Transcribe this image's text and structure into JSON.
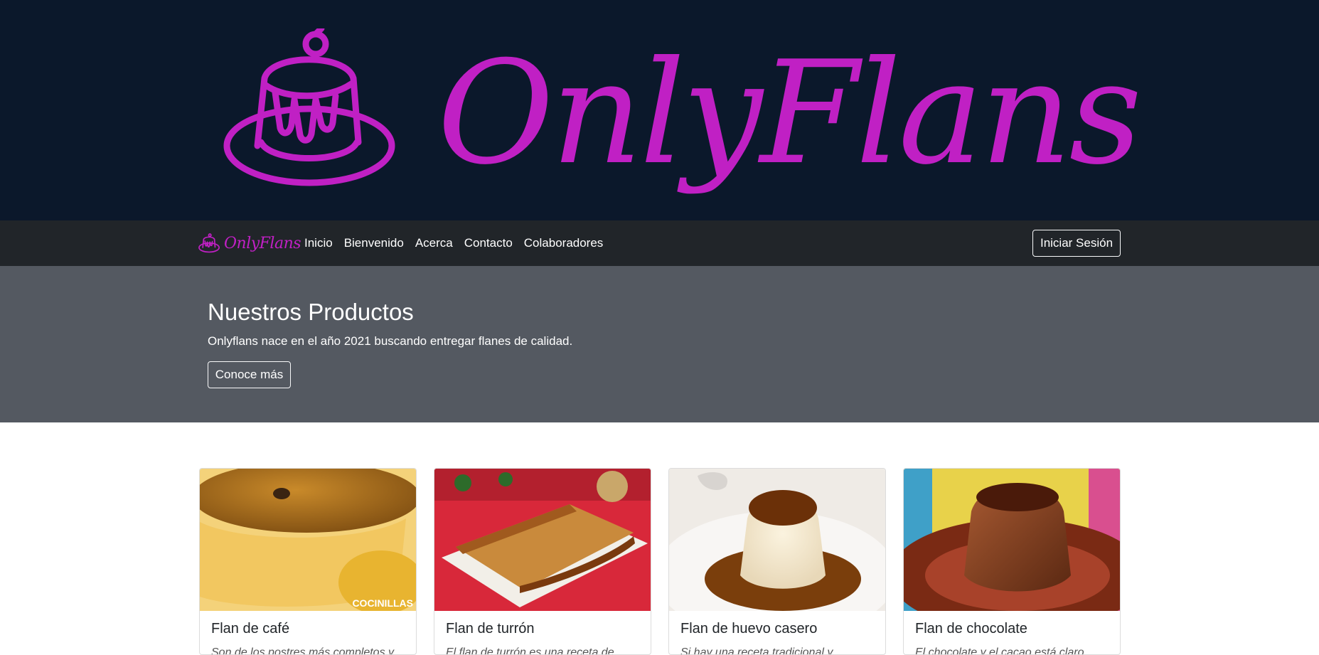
{
  "banner": {
    "logo_text": "OnlyFlans"
  },
  "navbar": {
    "brand": "OnlyFlans",
    "links": [
      "Inicio",
      "Bienvenido",
      "Acerca",
      "Contacto",
      "Colaboradores"
    ],
    "login_label": "Iniciar Sesión"
  },
  "hero": {
    "title": "Nuestros Productos",
    "subtitle": "Onlyflans nace en el año 2021 buscando entregar flanes de calidad.",
    "button_label": "Conoce más"
  },
  "products": [
    {
      "title": "Flan de café",
      "description": "Son de los postres más completos y"
    },
    {
      "title": "Flan de turrón",
      "description": "El flan de turrón es una receta de"
    },
    {
      "title": "Flan de huevo casero",
      "description": "Si hay una receta tradicional y"
    },
    {
      "title": "Flan de chocolate",
      "description": "El chocolate y el cacao está claro"
    }
  ],
  "image_watermark": "COCINILLAS",
  "colors": {
    "brand": "#c020c4",
    "banner_bg": "#0b182b",
    "navbar_bg": "#212529",
    "hero_bg": "#545961"
  }
}
